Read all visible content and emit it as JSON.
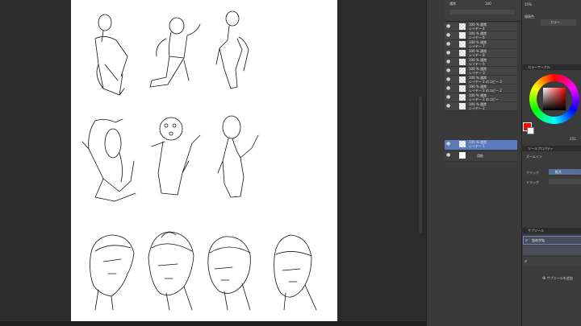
{
  "layers": [
    {
      "line1": "100 % 通常",
      "line2": "レイヤー 4"
    },
    {
      "line1": "100 % 通常",
      "line2": "レイヤー 6"
    },
    {
      "line1": "100 % 通常",
      "line2": "レイヤー 7"
    },
    {
      "line1": "100 % 通常",
      "line2": "レイヤー 8"
    },
    {
      "line1": "100 % 通常",
      "line2": "レイヤー 5"
    },
    {
      "line1": "100 % 通常",
      "line2": "レイヤー 3"
    },
    {
      "line1": "100 % 通常",
      "line2": "レイヤー 2 のコピー 3"
    },
    {
      "line1": "100 % 通常",
      "line2": "レイヤー 2 のコピー 2"
    },
    {
      "line1": "100 % 通常",
      "line2": "レイヤー 2 のコピー"
    },
    {
      "line1": "100 % 通常",
      "line2": "レイヤー 2"
    },
    {
      "line1": "100 % 通常",
      "line2": "レイヤー 1"
    },
    {
      "line1": "",
      "line2": "用紙"
    }
  ],
  "layer_top": {
    "blend": "通常",
    "opacity": "100"
  },
  "right": {
    "top_label": "15%",
    "mode_label": "描画色",
    "color_btn": "カラー",
    "wheel_head": "カラーサークル",
    "wheel_value": "255",
    "tool_prop_head": "ツールプロパティ",
    "tool_name": "ズームイン",
    "click_label": "クリック",
    "click_value": "拡大",
    "drag_label": "ドラッグ",
    "sub_head": "サブツール",
    "search_text": "虫めがね",
    "add_subtool": "サブツールを追加"
  },
  "colors": {
    "main": "#ff0000",
    "sub": "#ffffff",
    "accent": "#5b7bbd"
  }
}
